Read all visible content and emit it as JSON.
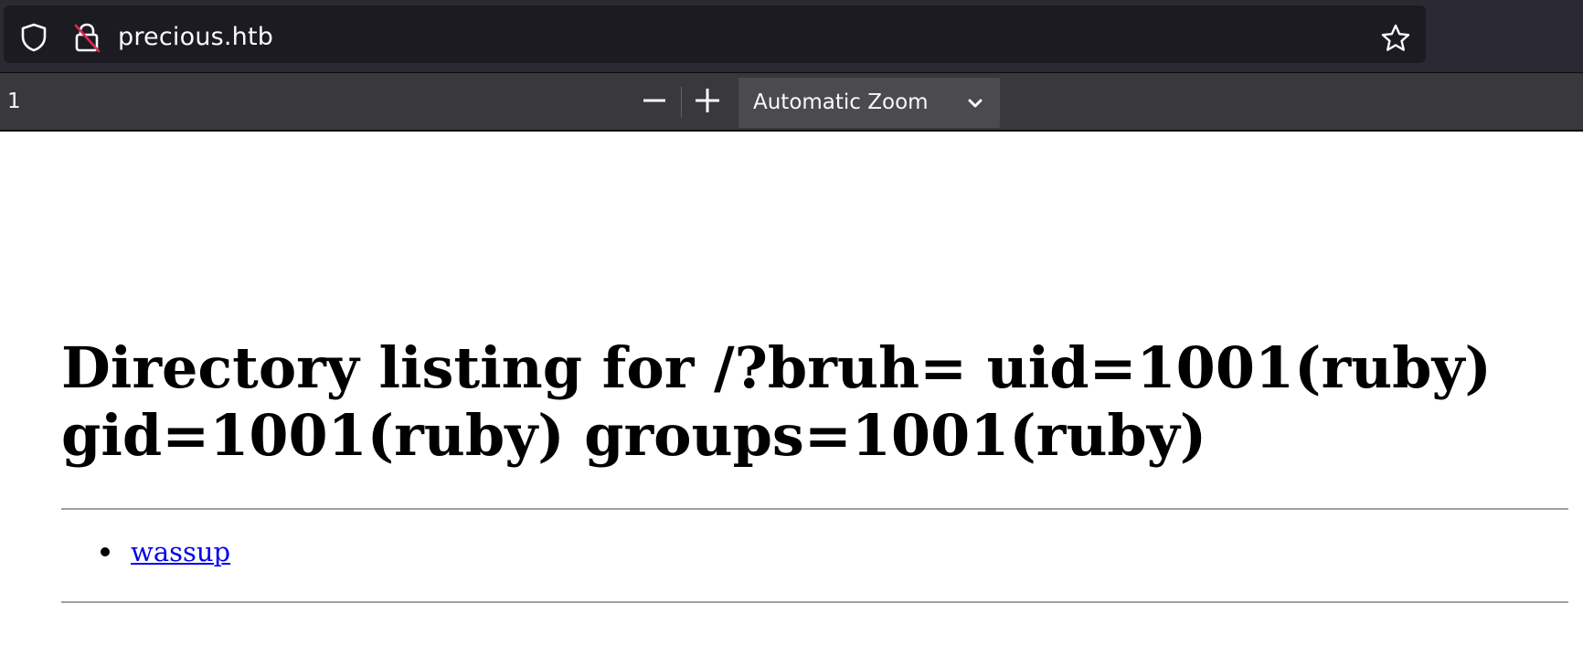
{
  "browser": {
    "url": "precious.htb",
    "icons": {
      "tracking_protection": "shield-icon",
      "connection": "insecure-lock-icon",
      "bookmark": "star-icon"
    }
  },
  "pdf_toolbar": {
    "page_number": "1",
    "zoom_out_icon": "minus-icon",
    "zoom_in_icon": "plus-icon",
    "zoom_value": "Automatic Zoom",
    "zoom_chevron_icon": "chevron-down-icon"
  },
  "page": {
    "heading": "Directory listing for /?bruh= uid=1001(ruby) gid=1001(ruby) groups=1001(ruby)",
    "files": [
      {
        "name": "wassup"
      }
    ]
  },
  "colors": {
    "chrome_bg": "#2b2a33",
    "urlbar_bg": "#1c1b22",
    "toolbar_bg": "#38383d",
    "link": "#0000ee"
  }
}
